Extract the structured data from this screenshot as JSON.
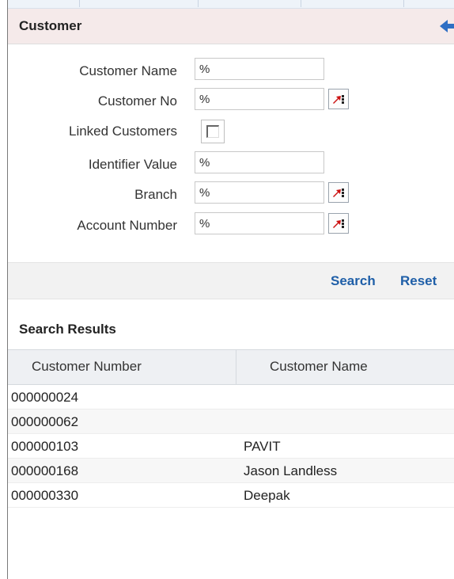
{
  "header": {
    "title": "Customer"
  },
  "form": {
    "customer_name": {
      "label": "Customer Name",
      "value": "%"
    },
    "customer_no": {
      "label": "Customer No",
      "value": "%"
    },
    "linked_customers": {
      "label": "Linked Customers",
      "checked": false
    },
    "identifier_value": {
      "label": "Identifier Value",
      "value": "%"
    },
    "branch": {
      "label": "Branch",
      "value": "%"
    },
    "account_number": {
      "label": "Account Number",
      "value": "%"
    }
  },
  "actions": {
    "search_label": "Search",
    "reset_label": "Reset"
  },
  "results": {
    "title": "Search Results",
    "columns": [
      "Customer Number",
      "Customer Name"
    ],
    "rows": [
      {
        "number": "000000024",
        "name": ""
      },
      {
        "number": "000000062",
        "name": ""
      },
      {
        "number": "000000103",
        "name": "PAVIT"
      },
      {
        "number": "000000168",
        "name": "Jason Landless"
      },
      {
        "number": "000000330",
        "name": "Deepak"
      }
    ]
  },
  "colors": {
    "link": "#1f5fa8",
    "header_bg": "#f5eaea",
    "lov_arrow": "#cc1111",
    "back_arrow": "#2f6fc4"
  },
  "icons": {
    "lov": "list-of-values-icon",
    "back": "back-arrow-icon"
  }
}
